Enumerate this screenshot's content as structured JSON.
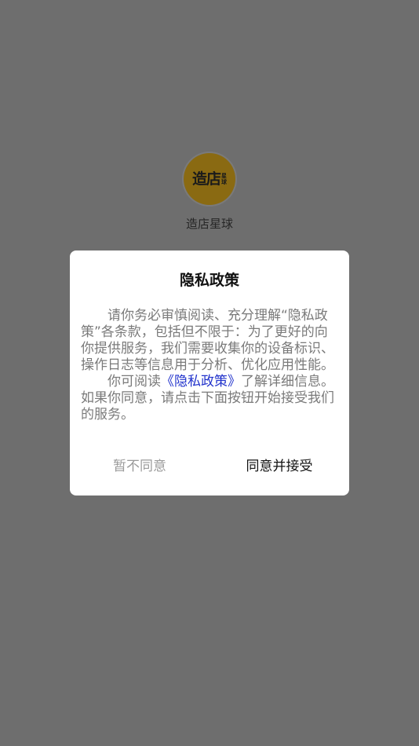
{
  "app": {
    "logo_text": "造店",
    "logo_small_top": "星",
    "logo_small_bottom": "球",
    "name": "造店星球"
  },
  "dialog": {
    "title": "隐私政策",
    "paragraph1": "请你务必审慎阅读、充分理解“隐私政策”各条款，包括但不限于：为了更好的向你提供服务，我们需要收集你的设备标识、操作日志等信息用于分析、优化应用性能。",
    "paragraph2_prefix": "你可阅读",
    "paragraph2_link": "《隐私政策》",
    "paragraph2_suffix": "了解详细信息。如果你同意，请点击下面按钮开始接受我们的服务。",
    "decline_label": "暂不同意",
    "accept_label": "同意并接受"
  },
  "colors": {
    "overlay": "#6e6e6e",
    "link": "#2233cc",
    "logo_background": "#8a6a12"
  }
}
